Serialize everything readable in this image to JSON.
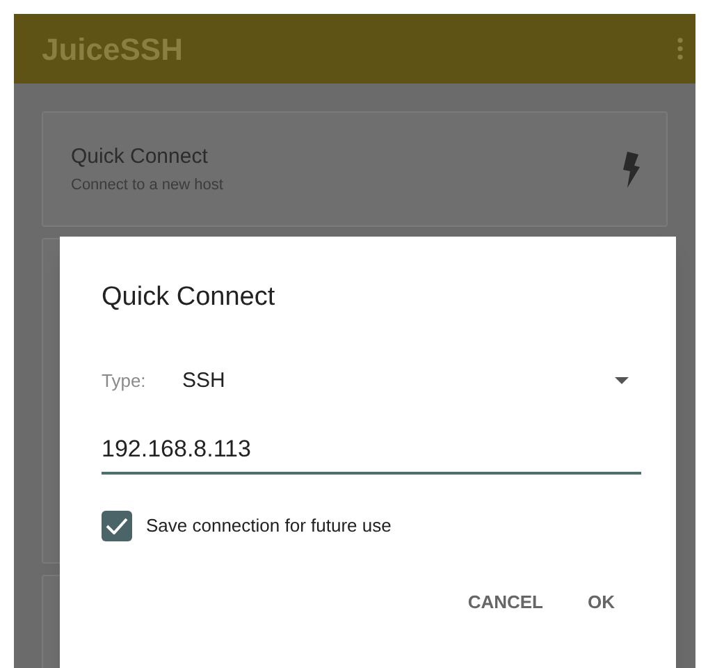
{
  "app_bar": {
    "title": "JuiceSSH"
  },
  "cards": [
    {
      "title": "Quick Connect",
      "subtitle": "Connect to a new host"
    }
  ],
  "dialog": {
    "title": "Quick Connect",
    "type_label": "Type:",
    "type_value": "SSH",
    "host": {
      "value": "192.168.8.113"
    },
    "save": {
      "label": "Save connection for future use",
      "checked": true
    },
    "buttons": [
      "CANCEL",
      "OK"
    ]
  }
}
